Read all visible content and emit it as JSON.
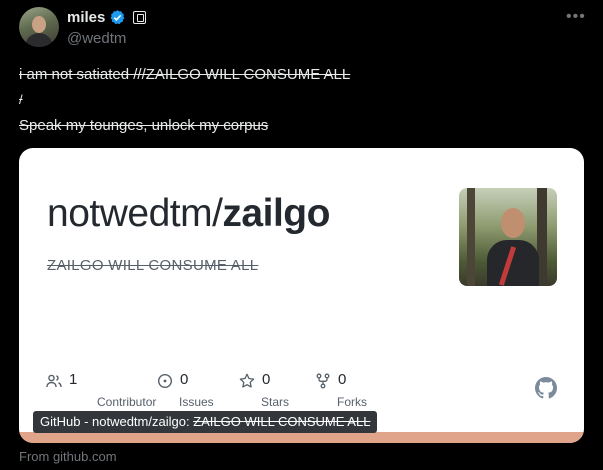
{
  "author": {
    "display_name": "miles",
    "handle": "@wedtm",
    "verified": true,
    "verified_color": "#1d9bf0",
    "avatar_icon": "user-avatar",
    "affiliation_icon": "affiliate-badge-icon"
  },
  "more_label": "•••",
  "tweet": {
    "line1": "i am not satiated ///ZAILGO WILL CONSUME ALL",
    "line2": "/",
    "line3": "Speak my tounges, unlock my corpus"
  },
  "card": {
    "owner": "notwedtm/",
    "repo": "zailgo",
    "description": "ZAILGO WILL CONSUME ALL",
    "stats": [
      {
        "icon": "contributors-icon",
        "value": "1",
        "label": "Contributor"
      },
      {
        "icon": "issues-icon",
        "value": "0",
        "label": "Issues"
      },
      {
        "icon": "star-icon",
        "value": "0",
        "label": "Stars"
      },
      {
        "icon": "fork-icon",
        "value": "0",
        "label": "Forks"
      }
    ],
    "logo_icon": "github-icon",
    "bar_color": "#e0a48b",
    "tooltip_prefix": "GitHub - notwedtm/zailgo: ",
    "tooltip_struck": "ZAILGO WILL CONSUME ALL"
  },
  "source": "From github.com"
}
